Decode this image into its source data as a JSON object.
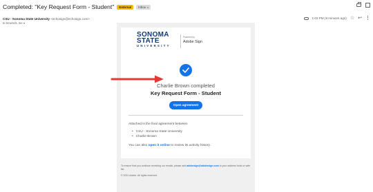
{
  "email": {
    "subject": "Completed: \"Key Request Form - Student\"",
    "labels": [
      "External",
      "Inbox"
    ],
    "label_close": "x",
    "sender_name": "CSU - Sonoma State University",
    "sender_email": "<echosign@echosign.com>",
    "to_text": "to brownc5, me",
    "timestamp": "1:03 PM (9 minutes ago)"
  },
  "icons": {
    "print": "print-icon",
    "open_in_new": "open-in-new-icon",
    "attachment": "attachment-icon",
    "star": "star-icon",
    "reply": "reply-icon",
    "more": "more-vert-icon",
    "check": "check-circle-icon"
  },
  "body": {
    "logo": {
      "line1": "SONOMA",
      "line2": "STATE",
      "line3": "UNIVERSITY"
    },
    "sign_small": "Powered by",
    "sign_name": "Adobe Sign",
    "completed_line": "Charlie Brown completed",
    "form_title": "Key Request Form - Student",
    "open_button": "Open agreement",
    "attached_intro": "Attached is the final agreement between",
    "parties": [
      "CSU - Sonoma State University",
      "Charlie Brown"
    ],
    "also_prefix": "You can also",
    "also_link": "open it online",
    "also_suffix": "to review its activity history.",
    "footer_prefix": "To ensure that you continue receiving our emails, please add",
    "footer_email": "adobesign@adobesign.com",
    "footer_suffix": "to your address book or safe list.",
    "copyright": "© 2021 Adobe. All rights reserved."
  },
  "colors": {
    "accent": "#1473e6",
    "logo_navy": "#0f3b74",
    "external_chip": "#fbbc04",
    "annotation_arrow": "#e53935"
  }
}
